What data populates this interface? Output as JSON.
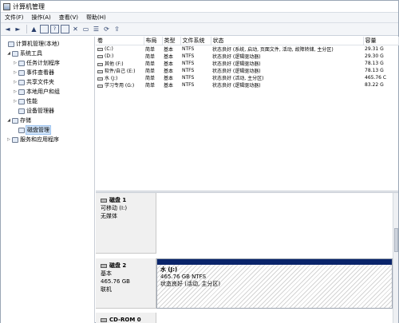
{
  "window": {
    "title": "计算机管理"
  },
  "menu": [
    "文件(F)",
    "操作(A)",
    "查看(V)",
    "帮助(H)"
  ],
  "toolbar": {
    "back": "◄",
    "forward": "►",
    "up": "▲",
    "help": "?",
    "delete": "✕",
    "page": "▭",
    "properties": "☰",
    "refresh": "⟳",
    "export": "⇪"
  },
  "tree": [
    {
      "label": "计算机管理(本地)",
      "expander": "",
      "level": 0
    },
    {
      "label": "系统工具",
      "expander": "◢",
      "level": 1
    },
    {
      "label": "任务计划程序",
      "expander": "▷",
      "level": 2
    },
    {
      "label": "事件查看器",
      "expander": "▷",
      "level": 2
    },
    {
      "label": "共享文件夹",
      "expander": "▷",
      "level": 2
    },
    {
      "label": "本地用户和组",
      "expander": "▷",
      "level": 2
    },
    {
      "label": "性能",
      "expander": "▷",
      "level": 2
    },
    {
      "label": "设备管理器",
      "expander": "",
      "level": 2
    },
    {
      "label": "存储",
      "expander": "◢",
      "level": 1
    },
    {
      "label": "磁盘管理",
      "expander": "",
      "level": 2,
      "selected": true
    },
    {
      "label": "服务和应用程序",
      "expander": "▷",
      "level": 1
    }
  ],
  "volumes": {
    "columns": [
      "卷",
      "布局",
      "类型",
      "文件系统",
      "状态",
      "容量"
    ],
    "rows": [
      [
        "(C:)",
        "简单",
        "基本",
        "NTFS",
        "状态良好 (系统, 启动, 页面文件, 活动, 故障转储, 主分区)",
        "29.31 G"
      ],
      [
        "(D:)",
        "简单",
        "基本",
        "NTFS",
        "状态良好 (逻辑驱动器)",
        "29.30 G"
      ],
      [
        "其他 (F:)",
        "简单",
        "基本",
        "NTFS",
        "状态良好 (逻辑驱动器)",
        "78.13 G"
      ],
      [
        "软件/自己 (E:)",
        "简单",
        "基本",
        "NTFS",
        "状态良好 (逻辑驱动器)",
        "78.13 G"
      ],
      [
        "水 (J:)",
        "简单",
        "基本",
        "NTFS",
        "状态良好 (活动, 主分区)",
        "465.76 C"
      ],
      [
        "学习专用 (G:)",
        "简单",
        "基本",
        "NTFS",
        "状态良好 (逻辑驱动器)",
        "83.22 G"
      ]
    ]
  },
  "disks": [
    {
      "name": "磁盘 1",
      "lines": [
        "可移动 (I:)",
        "",
        "无媒体"
      ]
    },
    {
      "name": "磁盘 2",
      "lines": [
        "基本",
        "465.76 GB",
        "联机"
      ],
      "partition": {
        "name": "水 (J:)",
        "size": "465.76 GB NTFS",
        "status": "状态良好 (活动, 主分区)"
      }
    },
    {
      "name": "CD-ROM 0",
      "lines": []
    }
  ],
  "colors": {
    "partition_header": "#0a246a",
    "selection": "#cfe3fa"
  }
}
